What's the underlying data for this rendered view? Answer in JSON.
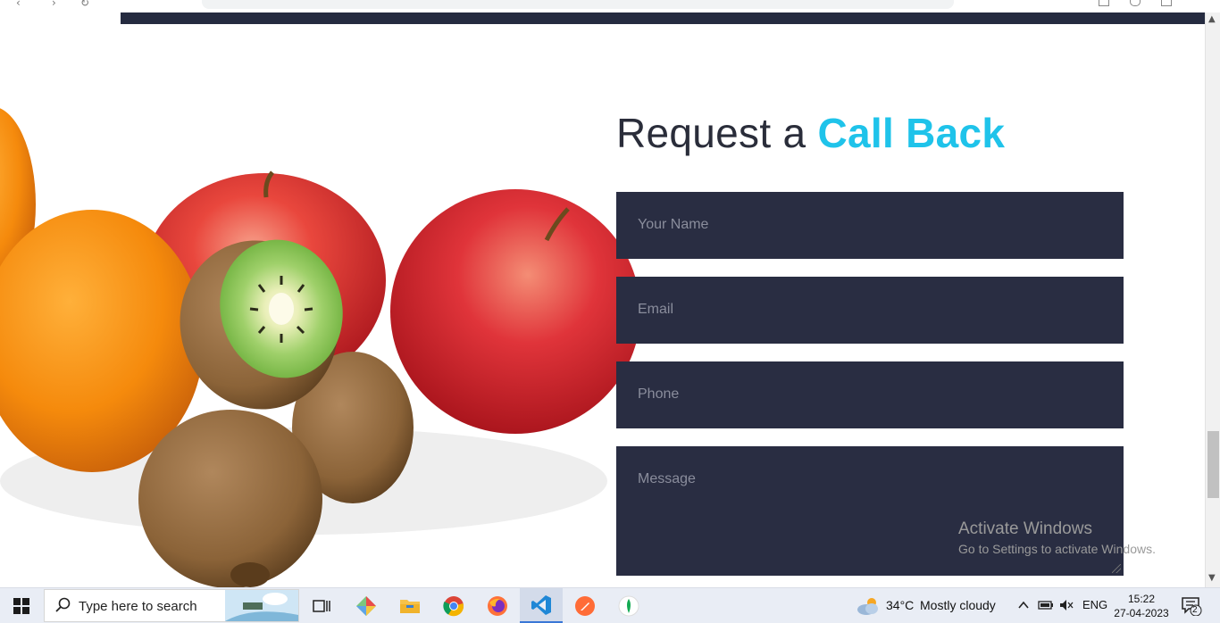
{
  "form": {
    "title_part1": "Request a ",
    "title_part2": "Call Back",
    "accent_color": "#1fc3ea",
    "field_bg_color": "#292d42",
    "name_placeholder": "Your Name",
    "email_placeholder": "Email",
    "phone_placeholder": "Phone",
    "message_placeholder": "Message"
  },
  "watermark": {
    "title": "Activate Windows",
    "subtitle": "Go to Settings to activate Windows."
  },
  "taskbar": {
    "search_placeholder": "Type here to search",
    "apps": [
      "task-view-icon",
      "git-icon",
      "file-explorer-icon",
      "chrome-icon",
      "firefox-icon",
      "vscode-icon",
      "postman-icon",
      "mongodb-compass-icon"
    ],
    "weather_temp": "34°C",
    "weather_desc": "Mostly cloudy",
    "language": "ENG",
    "time": "15:22",
    "date": "27-04-2023",
    "notification_count": "2"
  }
}
